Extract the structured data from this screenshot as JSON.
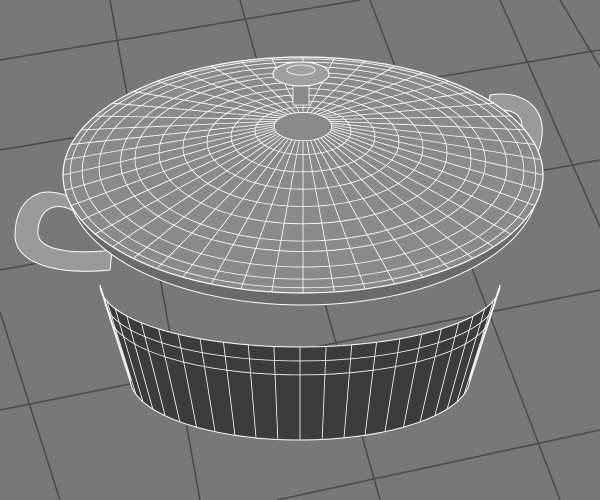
{
  "colors": {
    "background": "#787878",
    "grid": "#4a4a4a",
    "lid": "#8a8a8a",
    "body": "#3c3c3c",
    "wire": "#ffffff"
  }
}
